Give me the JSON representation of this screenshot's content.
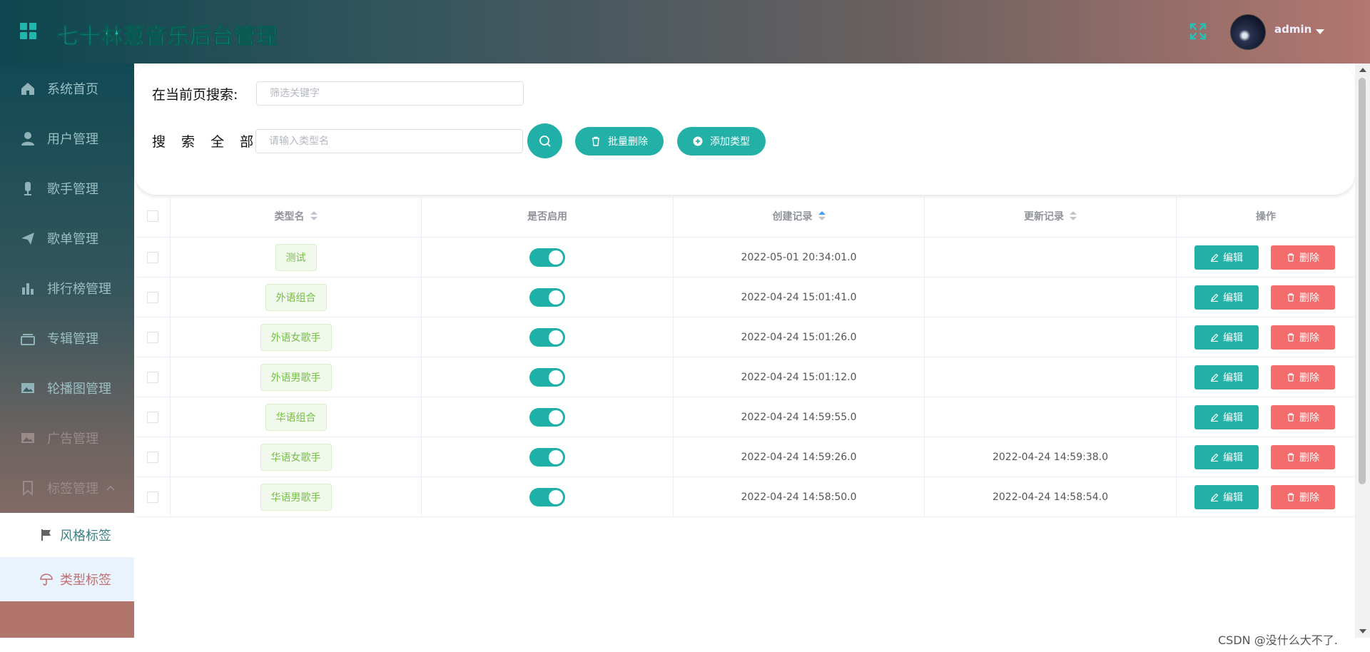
{
  "header": {
    "title": "七十林葱音乐后台管理",
    "user_name": "admin",
    "colors": {
      "accent": "#22b0a7",
      "danger": "#f46c6c",
      "tag_text": "#74c043"
    }
  },
  "sidebar": {
    "items": [
      {
        "label": "系统首页",
        "icon": "home-icon"
      },
      {
        "label": "用户管理",
        "icon": "user-icon"
      },
      {
        "label": "歌手管理",
        "icon": "microphone-icon"
      },
      {
        "label": "歌单管理",
        "icon": "send-icon"
      },
      {
        "label": "排行榜管理",
        "icon": "bar-chart-icon"
      },
      {
        "label": "专辑管理",
        "icon": "album-icon"
      },
      {
        "label": "轮播图管理",
        "icon": "picture-icon"
      },
      {
        "label": "广告管理",
        "icon": "picture-icon"
      },
      {
        "label": "标签管理",
        "icon": "bookmark-icon"
      }
    ],
    "sub_items": [
      {
        "label": "风格标签",
        "icon": "flag-icon"
      },
      {
        "label": "类型标签",
        "icon": "umbrella-icon"
      }
    ]
  },
  "search": {
    "current_label": "在当前页搜索:",
    "current_placeholder": "筛选关键字",
    "all_label": "搜 索 全 部:",
    "all_placeholder": "请输入类型名",
    "batch_delete_label": "批量删除",
    "add_type_label": "添加类型"
  },
  "table": {
    "headers": {
      "name": "类型名",
      "enabled": "是否启用",
      "created": "创建记录",
      "updated": "更新记录",
      "actions": "操作"
    },
    "rows": [
      {
        "name": "测试",
        "enabled": true,
        "created": "2022-05-01 20:34:01.0",
        "updated": ""
      },
      {
        "name": "外语组合",
        "enabled": true,
        "created": "2022-04-24 15:01:41.0",
        "updated": ""
      },
      {
        "name": "外语女歌手",
        "enabled": true,
        "created": "2022-04-24 15:01:26.0",
        "updated": ""
      },
      {
        "name": "外语男歌手",
        "enabled": true,
        "created": "2022-04-24 15:01:12.0",
        "updated": ""
      },
      {
        "name": "华语组合",
        "enabled": true,
        "created": "2022-04-24 14:59:55.0",
        "updated": ""
      },
      {
        "name": "华语女歌手",
        "enabled": true,
        "created": "2022-04-24 14:59:26.0",
        "updated": "2022-04-24 14:59:38.0"
      },
      {
        "name": "华语男歌手",
        "enabled": true,
        "created": "2022-04-24 14:58:50.0",
        "updated": "2022-04-24 14:58:54.0"
      }
    ],
    "edit_label": "编辑",
    "delete_label": "删除"
  },
  "watermark": "CSDN @没什么大不了."
}
